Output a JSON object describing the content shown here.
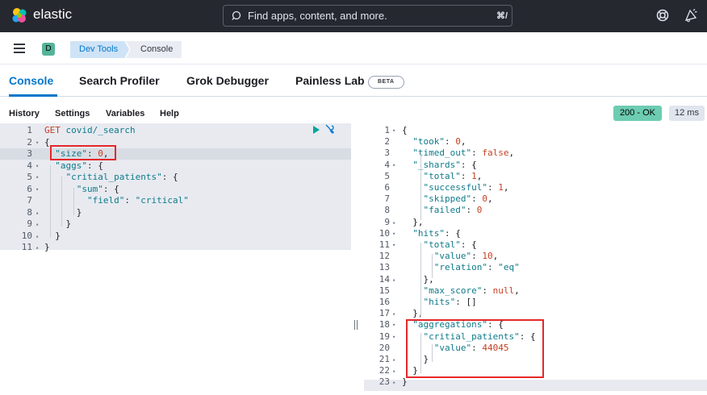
{
  "header": {
    "brand": "elastic",
    "search_placeholder": "Find apps, content, and more.",
    "search_shortcut": "⌘/"
  },
  "breadcrumbs": {
    "space_initial": "D",
    "items": [
      "Dev Tools",
      "Console"
    ]
  },
  "tabs": [
    {
      "label": "Console",
      "active": true
    },
    {
      "label": "Search Profiler",
      "active": false
    },
    {
      "label": "Grok Debugger",
      "active": false
    },
    {
      "label": "Painless Lab",
      "active": false
    }
  ],
  "beta_badge": "BETA",
  "menu": [
    "History",
    "Settings",
    "Variables",
    "Help"
  ],
  "status": {
    "code_text": "200 - OK",
    "time_text": "12 ms"
  },
  "request": {
    "lines": [
      "GET covid/_search",
      "{",
      "  \"size\": 0,",
      "  \"aggs\": {",
      "    \"critial_patients\": {",
      "      \"sum\": {",
      "        \"field\": \"critical\"",
      "      }",
      "    }",
      "  }",
      "}"
    ]
  },
  "response": {
    "lines": [
      "{",
      "  \"took\": 0,",
      "  \"timed_out\": false,",
      "  \"_shards\": {",
      "    \"total\": 1,",
      "    \"successful\": 1,",
      "    \"skipped\": 0,",
      "    \"failed\": 0",
      "  },",
      "  \"hits\": {",
      "    \"total\": {",
      "      \"value\": 10,",
      "      \"relation\": \"eq\"",
      "    },",
      "    \"max_score\": null,",
      "    \"hits\": []",
      "  },",
      "  \"aggregations\": {",
      "    \"critial_patients\": {",
      "      \"value\": 44045",
      "    }",
      "  }",
      "}"
    ]
  },
  "colors": {
    "accent": "#0077cc",
    "success": "#6dccb1",
    "highlight_box": "#e4282b",
    "header_bg": "#25282f"
  },
  "icons": [
    "elastic-logo-icon",
    "search-icon",
    "help-icon",
    "newsfeed-icon",
    "menu-icon",
    "run-icon",
    "wrench-icon"
  ]
}
